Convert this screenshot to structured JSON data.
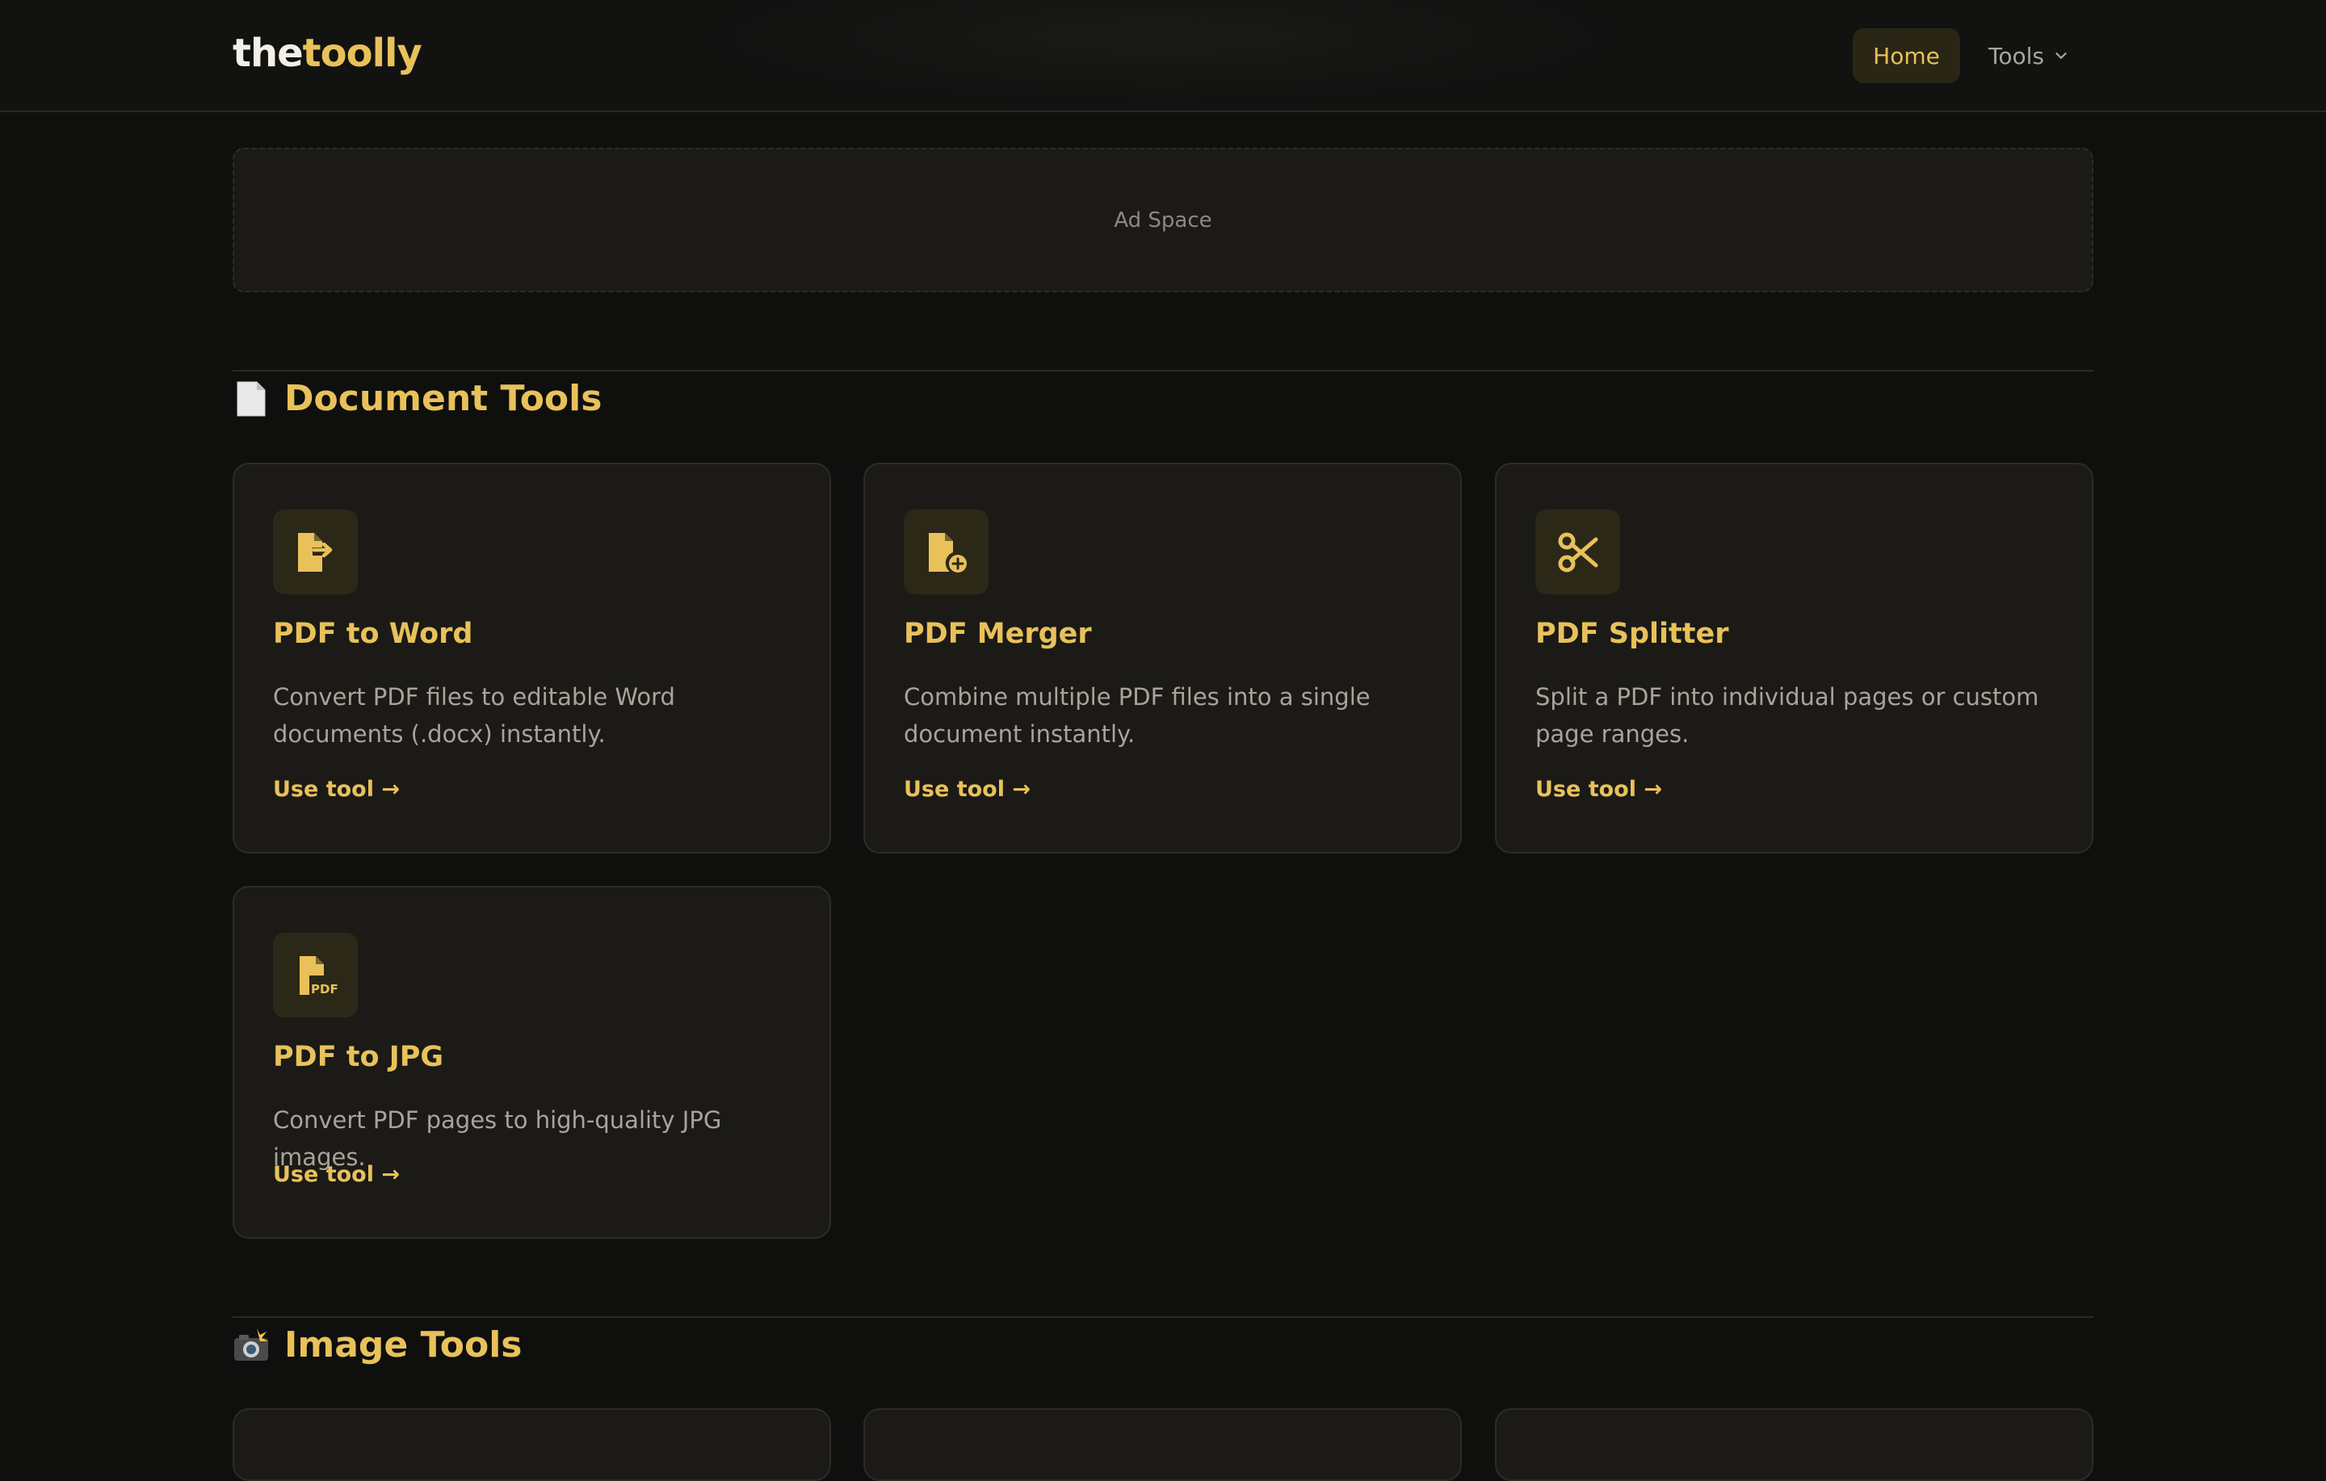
{
  "header": {
    "logo_part1": "the",
    "logo_part2": "toolly",
    "nav": {
      "home_label": "Home",
      "tools_label": "Tools"
    }
  },
  "ad": {
    "label": "Ad Space"
  },
  "sections": [
    {
      "title": "Document Tools",
      "icon": "page-emoji-icon",
      "cards": [
        {
          "title": "PDF to Word",
          "description": "Convert PDF files to editable Word documents (.docx) instantly.",
          "link": "Use tool →",
          "icon": "file-export-icon"
        },
        {
          "title": "PDF Merger",
          "description": "Combine multiple PDF files into a single document instantly.",
          "link": "Use tool →",
          "icon": "file-add-icon"
        },
        {
          "title": "PDF Splitter",
          "description": "Split a PDF into individual pages or custom page ranges.",
          "link": "Use tool →",
          "icon": "scissors-icon"
        },
        {
          "title": "PDF to JPG",
          "description": "Convert PDF pages to high-quality JPG images.",
          "link": "Use tool →",
          "icon": "file-pdf-icon"
        }
      ]
    },
    {
      "title": "Image Tools",
      "icon": "camera-flash-emoji-icon"
    }
  ],
  "colors": {
    "background": "#0f0f0e",
    "accent": "#e8c15a",
    "card": "#1b1a17",
    "muted_text": "#a8a49a"
  }
}
